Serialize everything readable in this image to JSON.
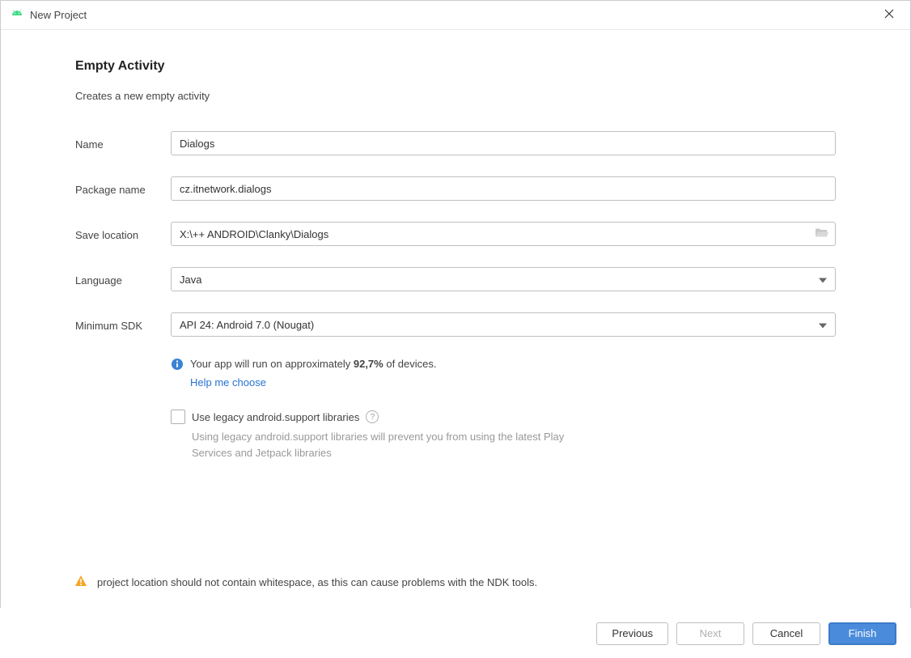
{
  "window": {
    "title": "New Project"
  },
  "page": {
    "heading": "Empty Activity",
    "subheading": "Creates a new empty activity"
  },
  "form": {
    "name_label": "Name",
    "name_value": "Dialogs",
    "package_label": "Package name",
    "package_value": "cz.itnetwork.dialogs",
    "location_label": "Save location",
    "location_value": "X:\\++ ANDROID\\Clanky\\Dialogs",
    "language_label": "Language",
    "language_value": "Java",
    "sdk_label": "Minimum SDK",
    "sdk_value": "API 24: Android 7.0 (Nougat)"
  },
  "info": {
    "text_prefix": "Your app will run on approximately ",
    "percent": "92,7%",
    "text_suffix": " of devices.",
    "help_link": "Help me choose"
  },
  "legacy": {
    "checkbox_label": "Use legacy android.support libraries",
    "note": "Using legacy android.support libraries will prevent you from using the latest Play Services and Jetpack libraries"
  },
  "warning": {
    "text": "project location should not contain whitespace, as this can cause problems with the NDK tools."
  },
  "footer": {
    "previous": "Previous",
    "next": "Next",
    "cancel": "Cancel",
    "finish": "Finish"
  }
}
